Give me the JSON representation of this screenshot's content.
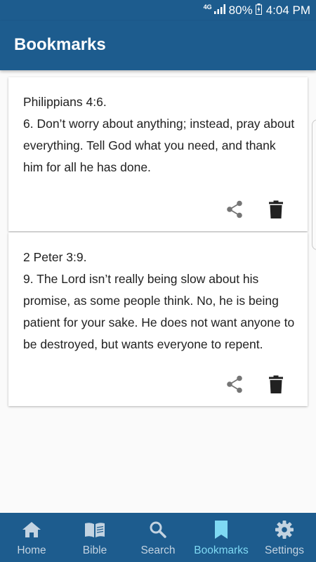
{
  "status_bar": {
    "network": "4G",
    "battery": "80%",
    "time": "4:04 PM"
  },
  "app_bar": {
    "title": "Bookmarks"
  },
  "bookmarks": [
    {
      "reference": "Philippians 4:6.",
      "verse": "6. Don’t worry about anything; instead, pray about everything. Tell God what you need, and thank him for all he has done."
    },
    {
      "reference": "2 Peter 3:9.",
      "verse": "9. The Lord isn’t really being slow about his promise, as some people think. No, he is being patient for your sake. He does not want anyone to be destroyed, but wants everyone to repent."
    }
  ],
  "bottom_nav": {
    "items": [
      {
        "label": "Home",
        "icon": "home-icon"
      },
      {
        "label": "Bible",
        "icon": "book-icon"
      },
      {
        "label": "Search",
        "icon": "search-icon"
      },
      {
        "label": "Bookmarks",
        "icon": "bookmark-icon",
        "active": true
      },
      {
        "label": "Settings",
        "icon": "gear-icon"
      }
    ]
  },
  "colors": {
    "primary": "#1d5c8e",
    "nav_active": "#7fd9f3",
    "nav_inactive": "#c3d3e1",
    "background": "#fafafa"
  }
}
